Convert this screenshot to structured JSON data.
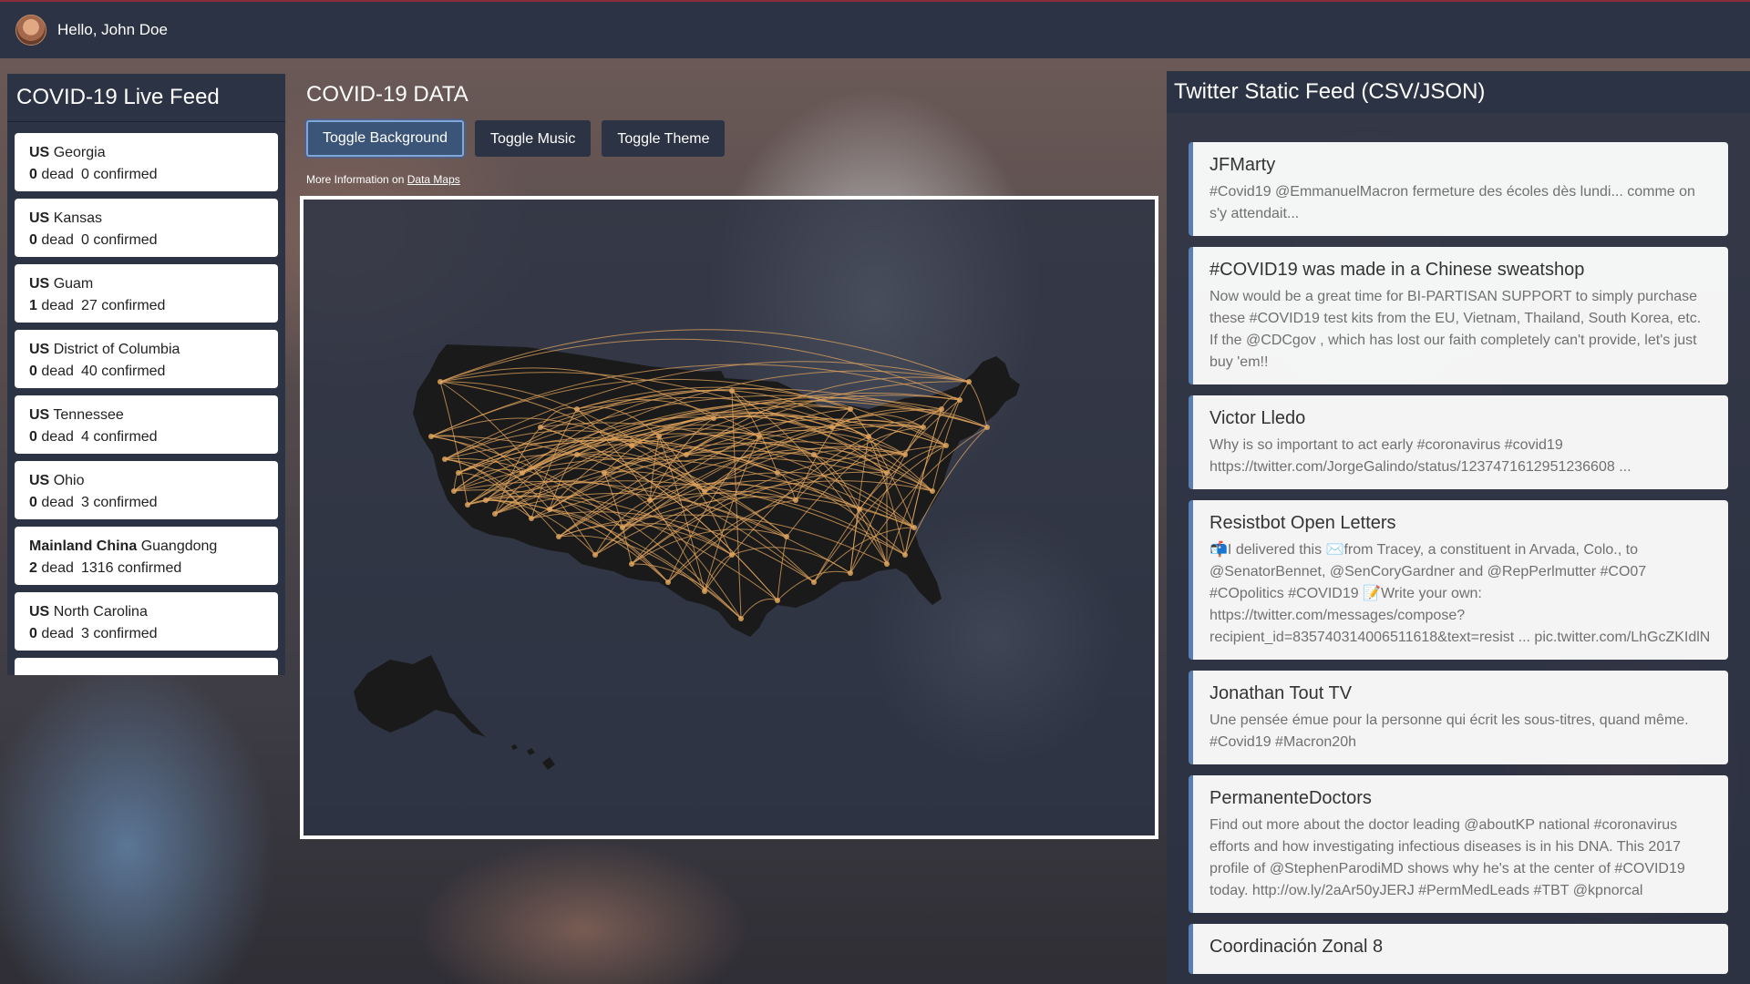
{
  "header": {
    "greeting": "Hello, John Doe"
  },
  "live_feed": {
    "title": "COVID-19 Live Feed",
    "dead_label": "dead",
    "confirmed_label": "confirmed",
    "items": [
      {
        "country": "US",
        "region": "Georgia",
        "dead": "0",
        "confirmed": "0"
      },
      {
        "country": "US",
        "region": "Kansas",
        "dead": "0",
        "confirmed": "0"
      },
      {
        "country": "US",
        "region": "Guam",
        "dead": "1",
        "confirmed": "27"
      },
      {
        "country": "US",
        "region": "District of Columbia",
        "dead": "0",
        "confirmed": "40"
      },
      {
        "country": "US",
        "region": "Tennessee",
        "dead": "0",
        "confirmed": "4"
      },
      {
        "country": "US",
        "region": "Ohio",
        "dead": "0",
        "confirmed": "3"
      },
      {
        "country": "Mainland China",
        "region": "Guangdong",
        "dead": "2",
        "confirmed": "1316"
      },
      {
        "country": "US",
        "region": "North Carolina",
        "dead": "0",
        "confirmed": "3"
      }
    ]
  },
  "main": {
    "title": "COVID-19 DATA",
    "buttons": {
      "background": "Toggle Background",
      "music": "Toggle Music",
      "theme": "Toggle Theme"
    },
    "more_info_prefix": "More Information on",
    "more_info_link": "Data Maps",
    "map_land_color": "#1a1a1a",
    "arc_color": "#e0a45e"
  },
  "twitter": {
    "title": "Twitter Static Feed (CSV/JSON)",
    "tweets": [
      {
        "user": "JFMarty",
        "text": "#Covid19 @EmmanuelMacron fermeture des écoles dès lundi... comme on s'y attendait..."
      },
      {
        "user": "#COVID19 was made in a Chinese sweatshop",
        "text": "Now would be a great time for BI-PARTISAN SUPPORT to simply purchase these #COVID19 test kits from the EU, Vietnam, Thailand, South Korea, etc. If the @CDCgov , which has lost our faith completely can't provide, let's just buy 'em!!"
      },
      {
        "user": "Victor Lledo",
        "text": "Why is so important to act early #coronavirus #covid19 https://twitter.com/JorgeGalindo/status/1237471612951236608 ..."
      },
      {
        "user": "Resistbot Open Letters",
        "text": "📬I delivered this ✉️from Tracey, a constituent in Arvada, Colo., to @SenatorBennet, @SenCoryGardner and @RepPerlmutter #CO07 #COpolitics #COVID19 📝Write your own: https://twitter.com/messages/compose?recipient_id=835740314006511618&text=resist ... pic.twitter.com/LhGcZKIdlN"
      },
      {
        "user": "Jonathan Tout TV",
        "text": "Une pensée émue pour la personne qui écrit les sous-titres, quand même. #Covid19 #Macron20h"
      },
      {
        "user": "PermanenteDoctors",
        "text": "Find out more about the doctor leading @aboutKP national #coronavirus efforts and how investigating infectious diseases is in his DNA. This 2017 profile of @StephenParodiMD shows why he's at the center of #COVID19 today. http://ow.ly/2aAr50yJERJ  #PermMedLeads #TBT @kpnorcal"
      },
      {
        "user": "Coordinación Zonal 8",
        "text": ""
      }
    ]
  }
}
